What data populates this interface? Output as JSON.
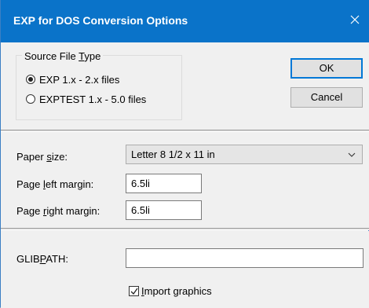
{
  "window": {
    "title": "EXP for DOS Conversion Options"
  },
  "source": {
    "legend": "Source File Type",
    "options": [
      {
        "label": "EXP 1.x - 2.x files",
        "selected": true
      },
      {
        "label": "EXPTEST 1.x - 5.0 files",
        "selected": false
      }
    ]
  },
  "buttons": {
    "ok": "OK",
    "cancel": "Cancel"
  },
  "paper": {
    "size_label": "Paper size:",
    "size_value": "Letter 8 1/2 x 11 in",
    "left_label": "Page left margin:",
    "left_value": "6.5li",
    "right_label": "Page right margin:",
    "right_value": "6.5li"
  },
  "glib": {
    "label": "GLIBPATH:",
    "value": "",
    "import_label": "Import graphics",
    "import_checked": true
  },
  "icons": {
    "close": "close-icon",
    "chevron": "chevron-down-icon",
    "check": "checkmark-icon"
  }
}
